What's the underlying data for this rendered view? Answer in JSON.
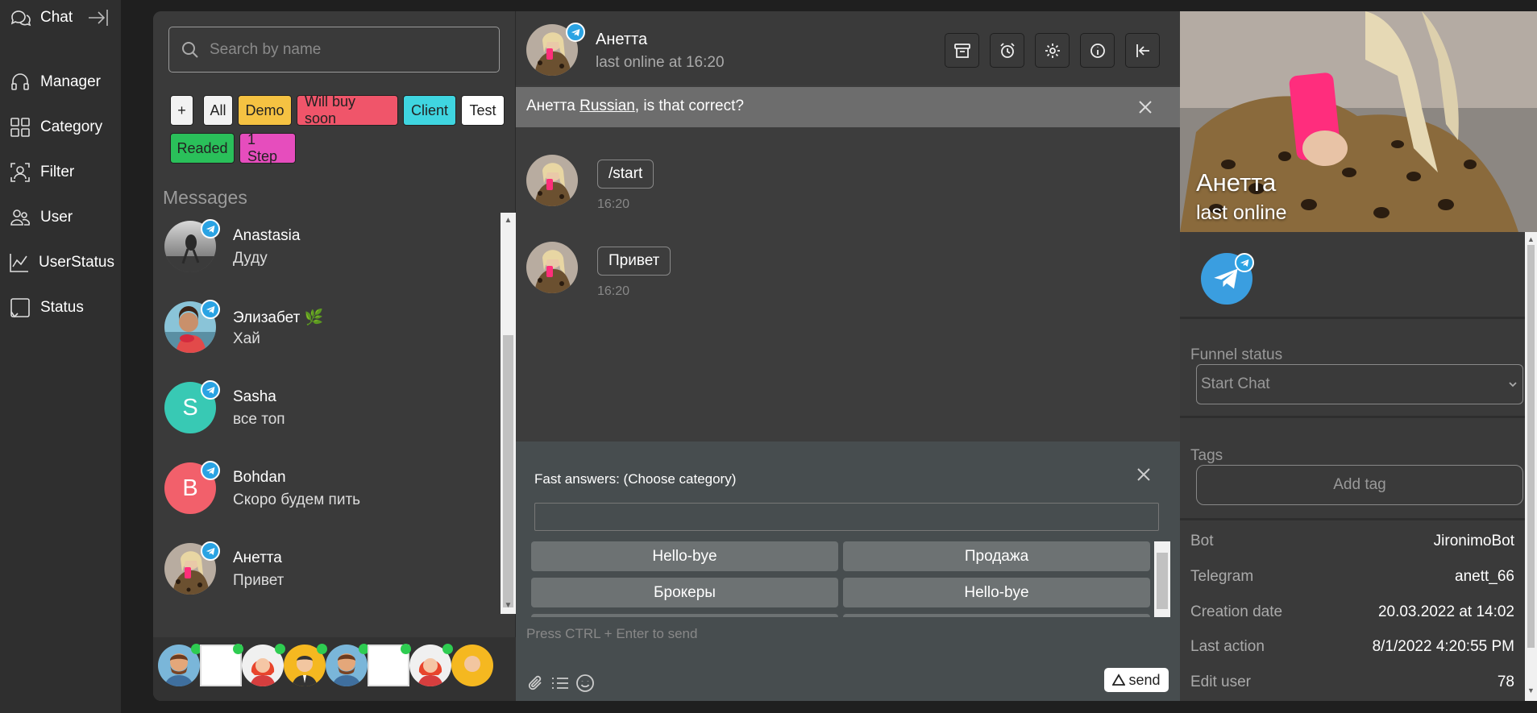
{
  "nav": {
    "items": [
      {
        "label": "Chat"
      },
      {
        "label": "Manager"
      },
      {
        "label": "Category"
      },
      {
        "label": "Filter"
      },
      {
        "label": "User"
      },
      {
        "label": "UserStatus"
      },
      {
        "label": "Status"
      }
    ]
  },
  "search": {
    "placeholder": "Search by name"
  },
  "tags": [
    {
      "label": "+",
      "bg": "#f2f2f2",
      "fg": "#222"
    },
    {
      "label": "All",
      "bg": "#f2f2f2",
      "fg": "#222"
    },
    {
      "label": "Demo",
      "bg": "#f5c242",
      "fg": "#222"
    },
    {
      "label": "Will buy soon",
      "bg": "#f0556a",
      "fg": "#222"
    },
    {
      "label": "Client",
      "bg": "#3fd5e0",
      "fg": "#222"
    },
    {
      "label": "Test",
      "bg": "#ffffff",
      "fg": "#222"
    },
    {
      "label": "Readed",
      "bg": "#2ac05a",
      "fg": "#222"
    },
    {
      "label": "1 Step",
      "bg": "#e64dbd",
      "fg": "#222"
    }
  ],
  "messages_title": "Messages",
  "chats": [
    {
      "name": "Anastasia",
      "last": "Дуду",
      "avatar": "photo"
    },
    {
      "name": "Элизабет 🌿",
      "last": "Хай",
      "avatar": "photo"
    },
    {
      "name": "Sasha",
      "last": "все топ",
      "avatar": "S",
      "color": "#38c9b4"
    },
    {
      "name": "Bohdan",
      "last": "Скоро будем пить",
      "avatar": "B",
      "color": "#f2606b"
    },
    {
      "name": "Анетта",
      "last": "Привет",
      "avatar": "photo"
    }
  ],
  "chat": {
    "name": "Анетта",
    "status": "last online at 16:20",
    "lang_prefix": "Анетта ",
    "lang_link": "Russian",
    "lang_suffix": ", is that correct?",
    "messages": [
      {
        "text": "/start",
        "time": "16:20"
      },
      {
        "text": "Привет",
        "time": "16:20"
      }
    ],
    "fast_title": "Fast answers: (Choose category)",
    "fast_buttons": [
      "Hello-bye",
      "Продажа",
      "Брокеры",
      "Hello-bye"
    ],
    "compose_placeholder": "Press CTRL + Enter to send",
    "send_label": "send"
  },
  "profile": {
    "name": "Анетта",
    "status": "last online",
    "funnel_label": "Funnel status",
    "funnel_value": "Start Chat",
    "tags_label": "Tags",
    "add_tag": "Add tag",
    "info": [
      {
        "k": "Bot",
        "v": "JironimoBot"
      },
      {
        "k": "Telegram",
        "v": "anett_66"
      },
      {
        "k": "Creation date",
        "v": "20.03.2022 at 14:02"
      },
      {
        "k": "Last action",
        "v": "8/1/2022 4:20:55 PM"
      },
      {
        "k": "Edit user",
        "v": "78"
      }
    ]
  },
  "colors": {
    "accent": "#2aa3e3",
    "online": "#2ecc51"
  }
}
